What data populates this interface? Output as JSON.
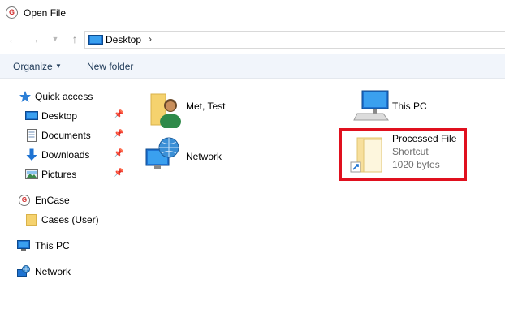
{
  "window": {
    "title": "Open File",
    "app_icon_letter": "G"
  },
  "navigation": {
    "address": "Desktop"
  },
  "toolbar": {
    "organize_label": "Organize",
    "new_folder_label": "New folder"
  },
  "sidebar": {
    "quick_access": "Quick access",
    "desktop": "Desktop",
    "documents": "Documents",
    "downloads": "Downloads",
    "pictures": "Pictures",
    "encase": "EnCase",
    "cases": "Cases (User)",
    "this_pc": "This PC",
    "network": "Network"
  },
  "items": {
    "user": {
      "name": "Met, Test"
    },
    "this_pc": {
      "name": "This PC"
    },
    "network": {
      "name": "Network"
    },
    "processed": {
      "name": "Processed File",
      "type": "Shortcut",
      "size": "1020 bytes"
    }
  },
  "colors": {
    "highlight": "#e0101e",
    "toolbar_bg": "#f1f5fb",
    "folder": "#f5d26e",
    "accent": "#1e73d2"
  }
}
